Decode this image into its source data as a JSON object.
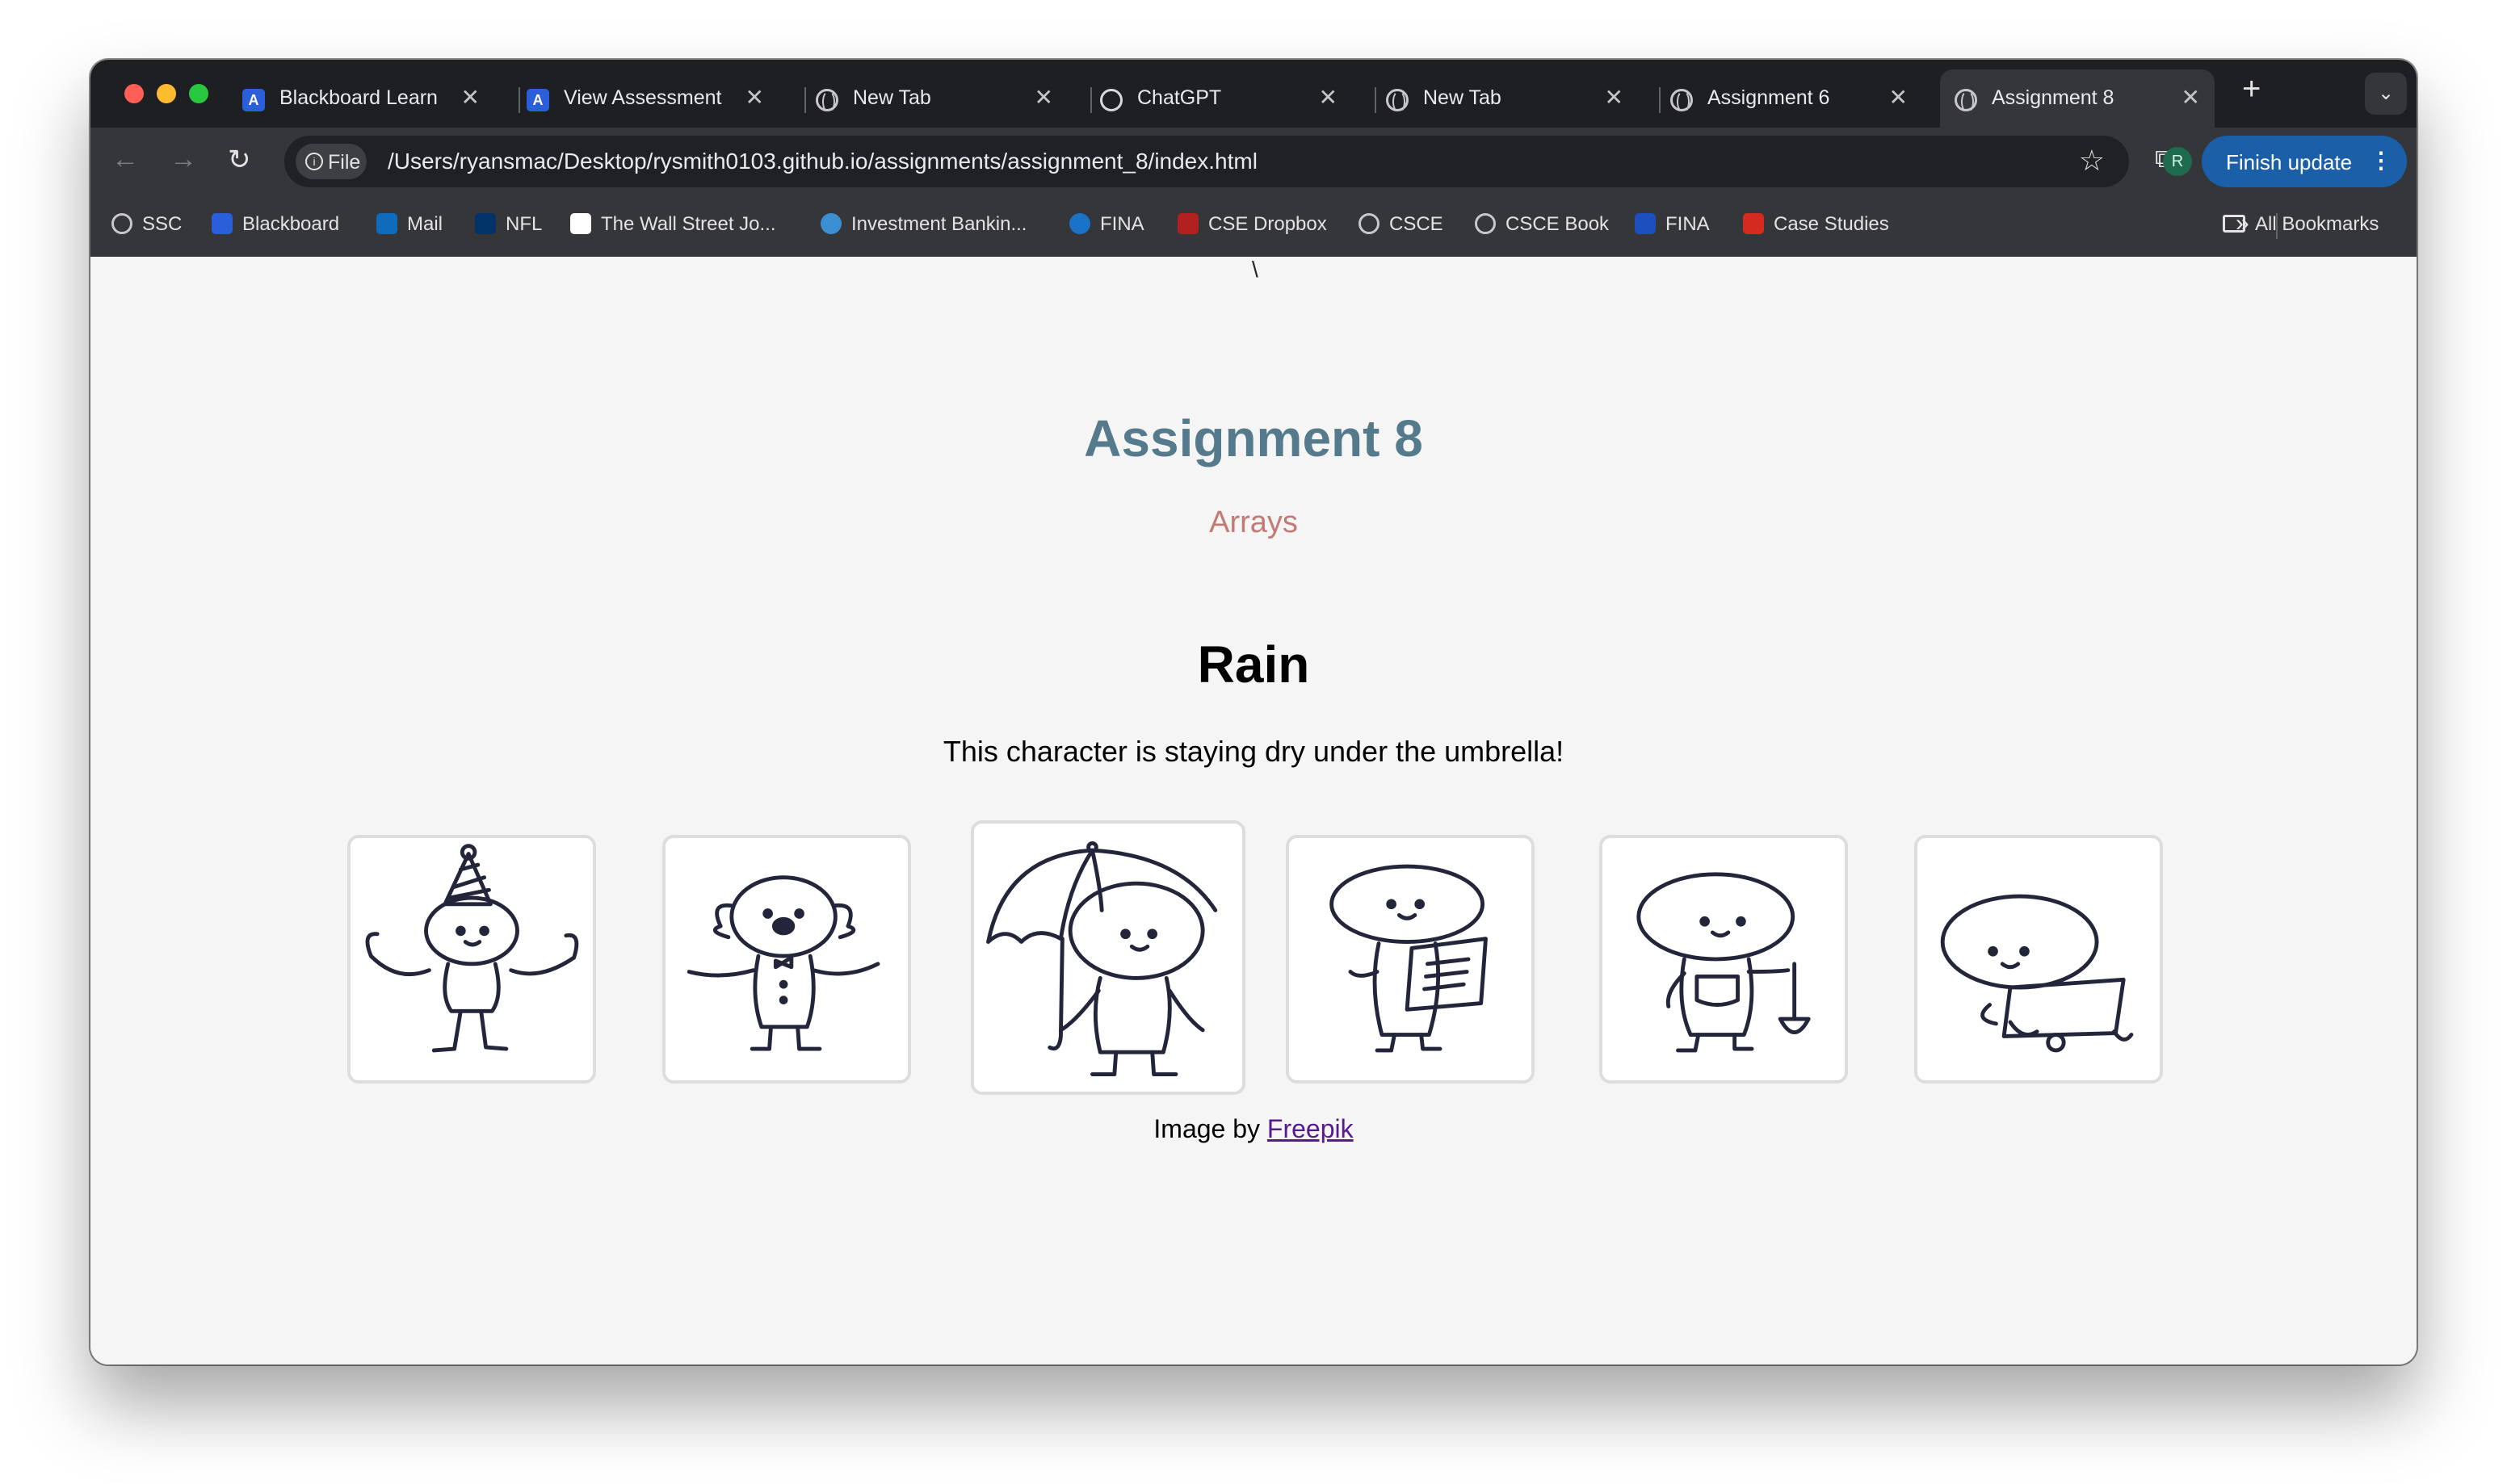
{
  "browser": {
    "tabs": [
      {
        "label": "Blackboard Learn",
        "icon": "blackboard-icon"
      },
      {
        "label": "View Assessment",
        "icon": "blackboard-icon"
      },
      {
        "label": "New Tab",
        "icon": "globe-icon"
      },
      {
        "label": "ChatGPT",
        "icon": "chatgpt-icon"
      },
      {
        "label": "New Tab",
        "icon": "globe-icon"
      },
      {
        "label": "Assignment 6",
        "icon": "globe-icon"
      },
      {
        "label": "Assignment 8",
        "icon": "globe-icon",
        "active": true
      }
    ],
    "address": {
      "chip_label": "File",
      "url": "/Users/ryansmac/Desktop/rysmith0103.github.io/assignments/assignment_8/index.html"
    },
    "profile_initial": "R",
    "update_button": "Finish update",
    "bookmarks": [
      {
        "label": "SSC"
      },
      {
        "label": "Blackboard"
      },
      {
        "label": "Mail"
      },
      {
        "label": "NFL"
      },
      {
        "label": "The Wall Street Jo..."
      },
      {
        "label": "Investment Bankin..."
      },
      {
        "label": "FINA"
      },
      {
        "label": "CSE Dropbox"
      },
      {
        "label": "CSCE"
      },
      {
        "label": "CSCE Book"
      },
      {
        "label": "FINA"
      },
      {
        "label": "Case Studies"
      }
    ],
    "all_bookmarks": "All Bookmarks",
    "colors": {
      "accent": "#1a5fa8",
      "chrome_dark": "#35363a"
    }
  },
  "page": {
    "stray_char": "\\",
    "title": "Assignment 8",
    "subtitle": "Arrays",
    "heading": "Rain",
    "description": "This character is staying dry under the umbrella!",
    "characters": [
      {
        "name": "party-hat-character"
      },
      {
        "name": "bowtie-character"
      },
      {
        "name": "umbrella-character",
        "selected": true
      },
      {
        "name": "reading-character"
      },
      {
        "name": "gardener-shovel-character"
      },
      {
        "name": "laptop-character"
      }
    ],
    "credit_prefix": "Image by",
    "credit_link": "Freepik",
    "colors": {
      "title": "#557a8c",
      "subtitle": "#c47a74"
    }
  }
}
